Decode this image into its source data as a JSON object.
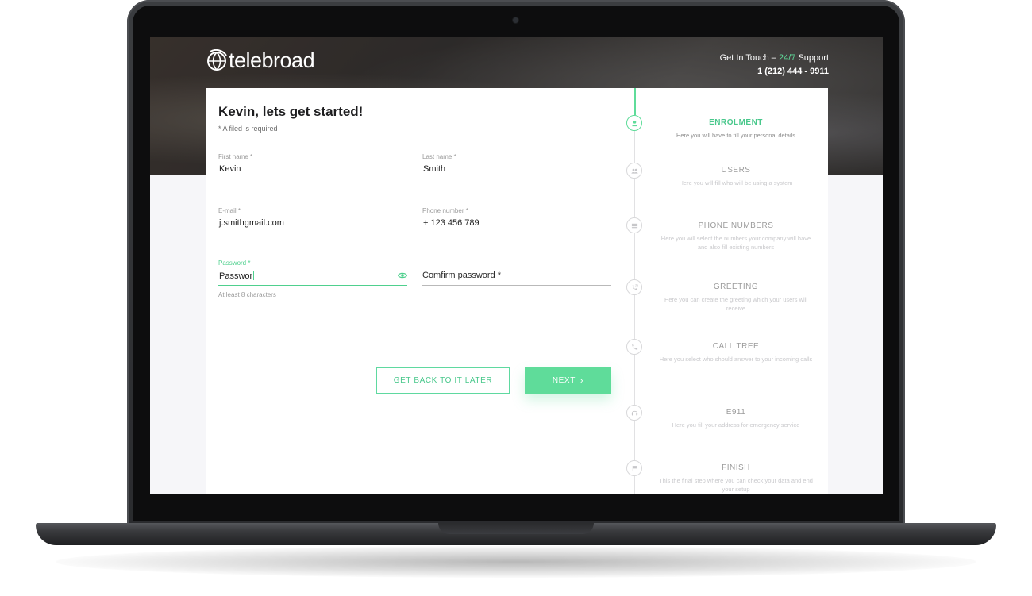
{
  "brand": {
    "name": "telebroad"
  },
  "contact": {
    "prefix": "Get In Touch –",
    "highlight": "24/7",
    "suffix": "Support",
    "phone": "1 (212) 444 - 9911"
  },
  "form": {
    "title": "Kevin, lets get started!",
    "required_note": "* A filed is required",
    "fields": {
      "first_name": {
        "label": "First name *",
        "value": "Kevin"
      },
      "last_name": {
        "label": "Last name *",
        "value": "Smith"
      },
      "email": {
        "label": "E-mail *",
        "value": "j.smithgmail.com"
      },
      "phone": {
        "label": "Phone number *",
        "value": "+ 123 456 789"
      },
      "password": {
        "label": "Password *",
        "value": "Passwor",
        "helper": "At least 8 characters"
      },
      "confirm_password": {
        "placeholder": "Comfirm password *"
      }
    },
    "buttons": {
      "later": "GET BACK TO IT LATER",
      "next": "NEXT"
    }
  },
  "steps": [
    {
      "title": "ENROLMENT",
      "desc": "Here you will have to fill your personal details",
      "icon": "person-icon",
      "active": true
    },
    {
      "title": "USERS",
      "desc": "Here you will fill who will be using a system",
      "icon": "group-icon",
      "active": false
    },
    {
      "title": "PHONE NUMBERS",
      "desc": "Here you will select the numbers your company will have and also fill existing numbers",
      "icon": "list-icon",
      "active": false
    },
    {
      "title": "GREETING",
      "desc": "Here you can create the greeting which your users will receive",
      "icon": "phone-forward-icon",
      "active": false
    },
    {
      "title": "CALL TREE",
      "desc": "Here you select who should answer to your incoming calls",
      "icon": "phone-icon",
      "active": false
    },
    {
      "title": "E911",
      "desc": "Here you fill your address for emergency service",
      "icon": "headset-icon",
      "active": false
    },
    {
      "title": "FINISH",
      "desc": "This the final step where you can check your data and end your setup",
      "icon": "flag-icon",
      "active": false
    }
  ],
  "colors": {
    "accent": "#5fdc9a",
    "text": "#1d1d1f"
  }
}
